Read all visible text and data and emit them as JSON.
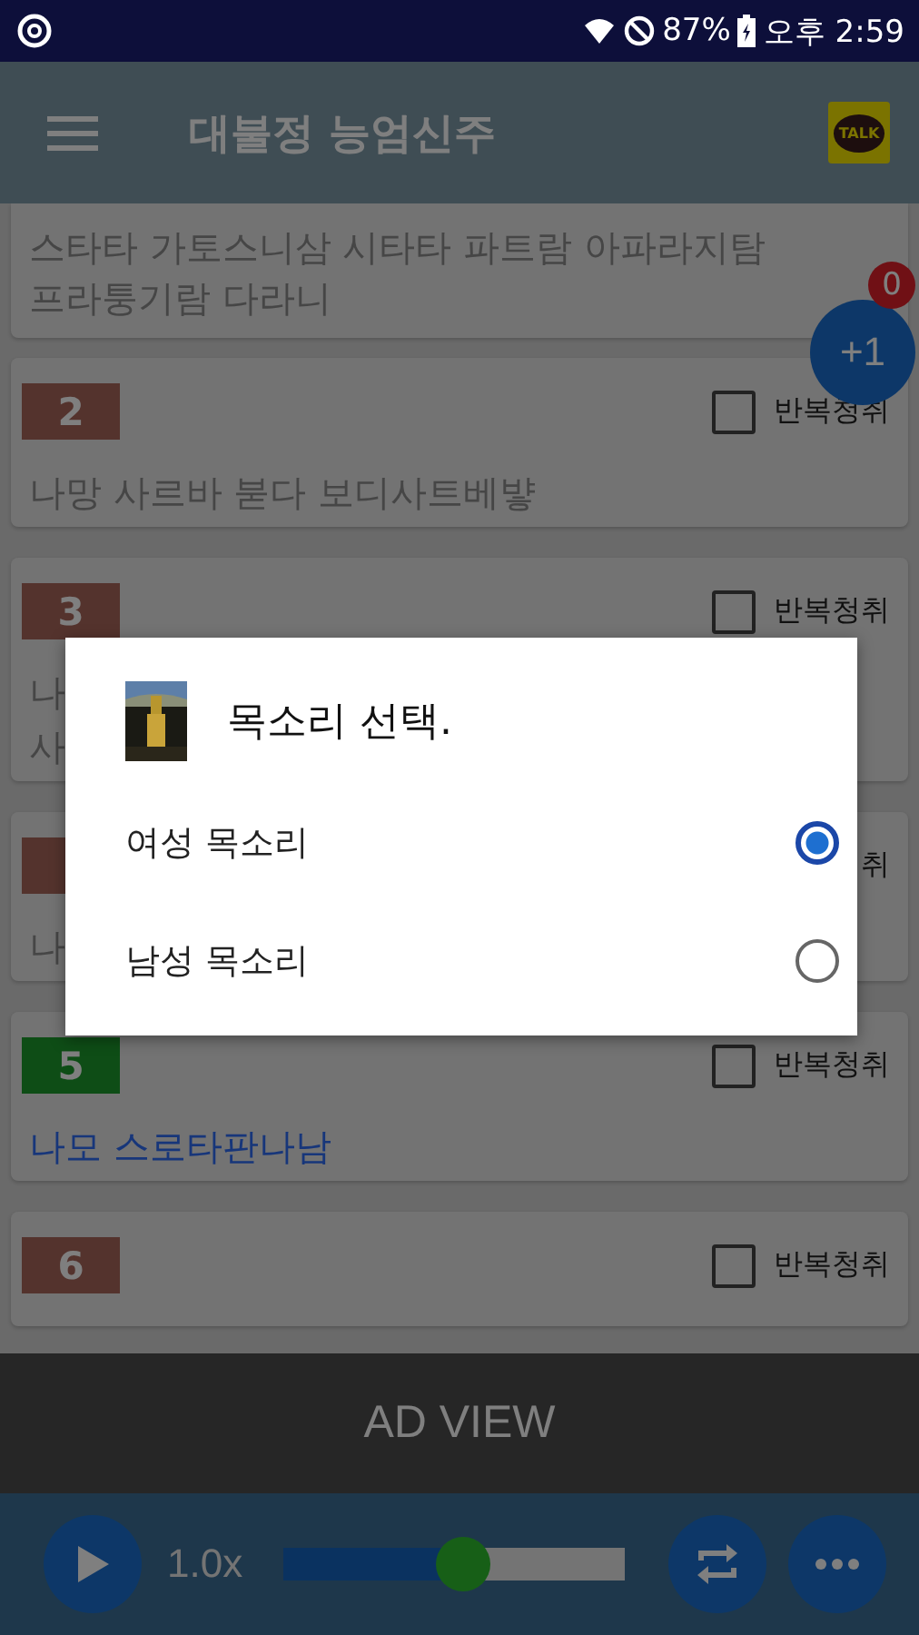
{
  "status_bar": {
    "battery": "87%",
    "time": "오후 2:59"
  },
  "toolbar": {
    "title": "대불정 능엄신주",
    "logo_text": "TALK"
  },
  "verses": [
    {
      "lines": [
        "스타타 가토스니삼 시타타 파트람 아파라지탐",
        "프라퉁기람 다라니"
      ],
      "current": false
    },
    {
      "number": "2",
      "current": false,
      "repeat": {
        "label": "반복청취",
        "checked": false
      },
      "lines": [
        "나망 사르바 붇다 보디사트베뱧"
      ]
    },
    {
      "number": "3",
      "current": false,
      "repeat": {
        "label": "반복청취",
        "checked": false
      },
      "lines": [
        "나",
        "사"
      ]
    },
    {
      "current": false,
      "repeat": {
        "label": "취"
      },
      "lines": [
        "나"
      ]
    },
    {
      "number": "5",
      "current": true,
      "repeat": {
        "label": "반복청취",
        "checked": false
      },
      "lines": [
        "나모 스로타판나남"
      ]
    },
    {
      "number": "6",
      "current": false,
      "repeat": {
        "label": "반복청취",
        "checked": false
      }
    }
  ],
  "fab": {
    "label": "+1",
    "count": "0"
  },
  "dialog": {
    "title": "목소리 선택.",
    "options": [
      {
        "label": "여성 목소리",
        "selected": true
      },
      {
        "label": "남성 목소리",
        "selected": false
      }
    ]
  },
  "ad_banner": {
    "label": "AD VIEW"
  },
  "player": {
    "speed": "1.0x",
    "position": {
      "level": 0.53
    }
  }
}
